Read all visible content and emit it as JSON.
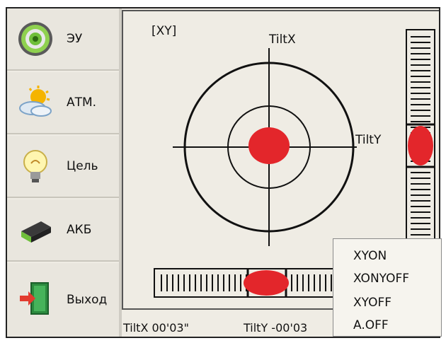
{
  "sidebar": {
    "items": [
      {
        "label": "ЭУ",
        "icon": "target-sensor-icon"
      },
      {
        "label": "АТМ.",
        "icon": "weather-icon"
      },
      {
        "label": "Цель",
        "icon": "lightbulb-icon"
      },
      {
        "label": "АКБ",
        "icon": "battery-icon"
      },
      {
        "label": "Выход",
        "icon": "exit-door-icon"
      }
    ]
  },
  "level": {
    "mode_label": "[XY]",
    "axis_x_label": "TiltX",
    "axis_y_label": "TiltY"
  },
  "status": {
    "tilt_x": "TiltX 00'03\"",
    "tilt_y": "TiltY -00'03"
  },
  "menu": {
    "options": [
      "XYON",
      "XONYOFF",
      "XYOFF",
      "A.OFF"
    ]
  },
  "colors": {
    "bubble": "#e3262b",
    "background": "#efece4"
  }
}
